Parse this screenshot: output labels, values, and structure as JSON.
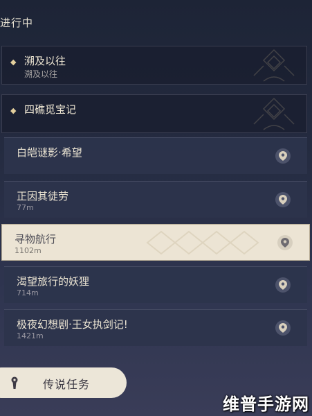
{
  "section_title": "进行中",
  "groups": [
    {
      "title": "溯及以往",
      "subtitle": "溯及以往"
    },
    {
      "title": "四礁觅宝记",
      "subtitle": ""
    }
  ],
  "quests": [
    {
      "name": "白皑谜影·希望",
      "distance": "",
      "selected": false
    },
    {
      "name": "正因其徒劳",
      "distance": "77m",
      "selected": false
    },
    {
      "name": "寻物航行",
      "distance": "1102m",
      "selected": true
    },
    {
      "name": "渴望旅行的妖狸",
      "distance": "714m",
      "selected": false
    },
    {
      "name": "极夜幻想剧·王女执剑记!",
      "distance": "1421m",
      "selected": false
    }
  ],
  "legend_button": {
    "label": "传说任务",
    "icon": "keyhole-icon"
  },
  "icons": {
    "group": "diamond-icon",
    "quest": "map-pin-icon"
  },
  "watermark": "维普手游网"
}
